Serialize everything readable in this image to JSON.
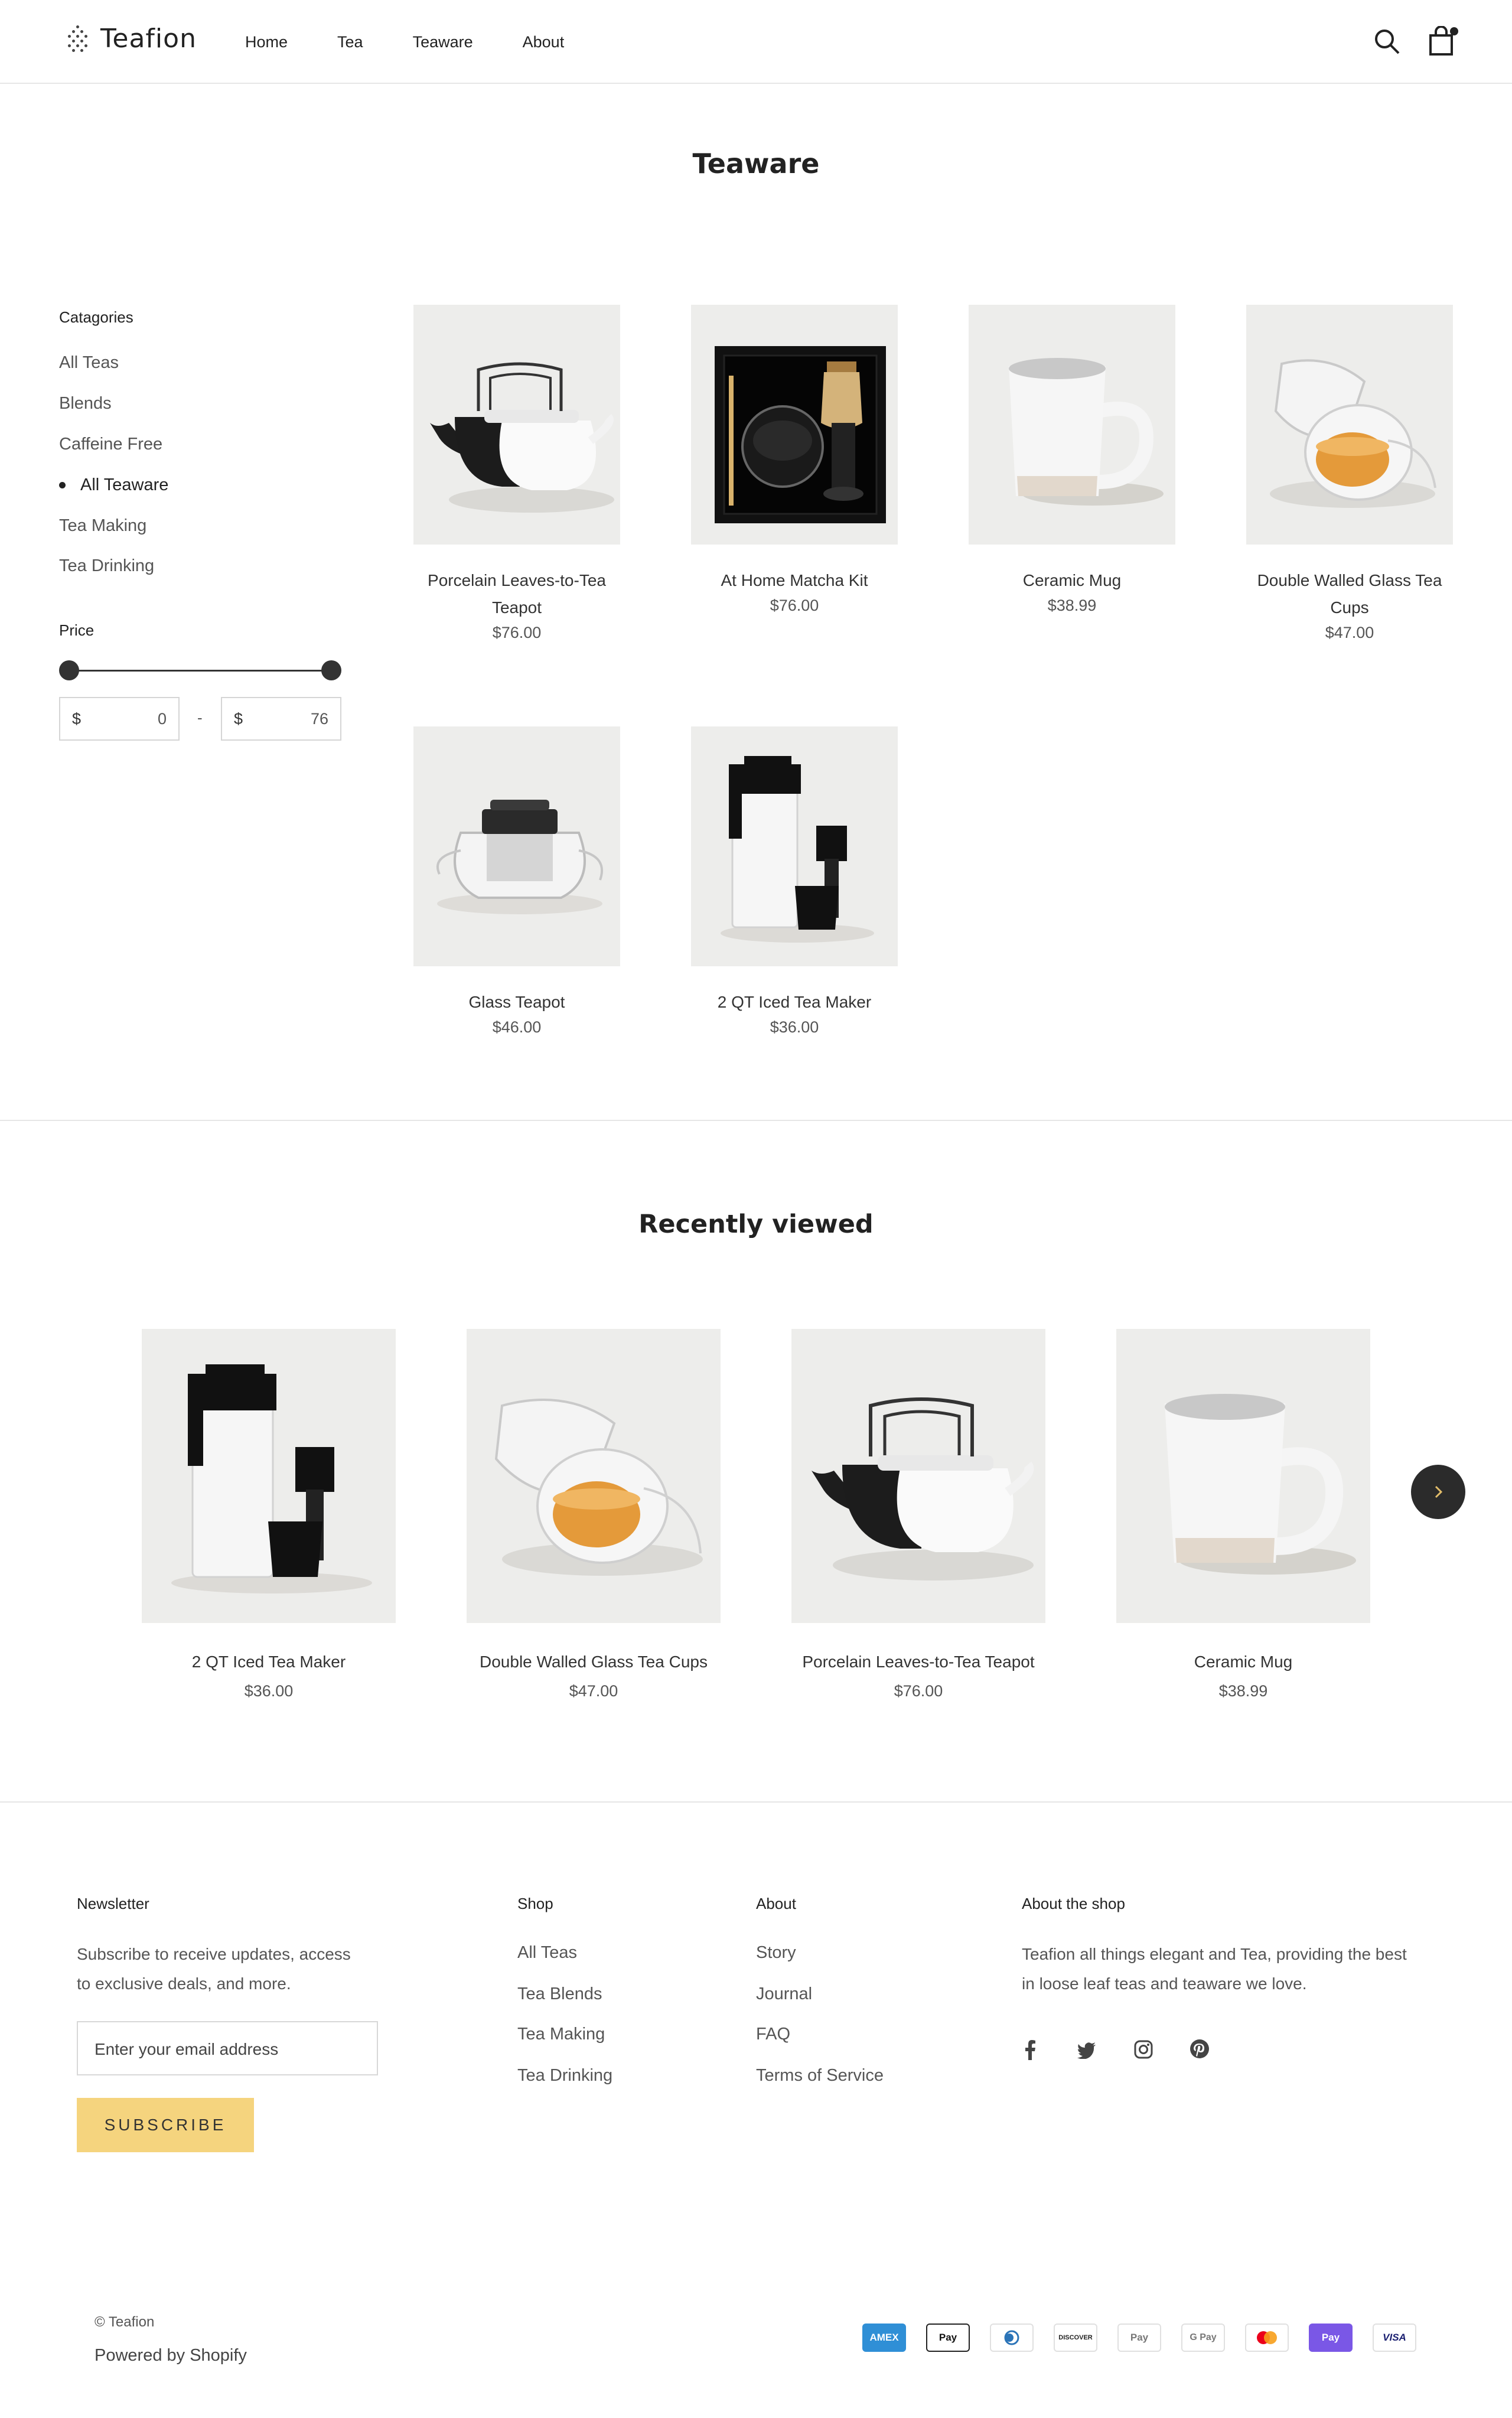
{
  "header": {
    "logo_text": "Teafion",
    "nav": [
      "Home",
      "Tea",
      "Teaware",
      "About"
    ],
    "icons": [
      "search-icon",
      "cart-icon"
    ]
  },
  "page": {
    "title": "Teaware"
  },
  "sidebar": {
    "categories_heading": "Catagories",
    "categories": [
      "All Teas",
      "Blends",
      "Caffeine Free",
      "All Teaware",
      "Tea Making",
      "Tea Drinking"
    ],
    "active_category": "All Teaware",
    "price_heading": "Price",
    "currency": "$",
    "price_min": "0",
    "price_max": "76",
    "price_separator": "-"
  },
  "products": [
    {
      "name": "Porcelain Leaves-to-Tea Teapot",
      "price": "$76.00"
    },
    {
      "name": "At Home Matcha Kit",
      "price": "$76.00"
    },
    {
      "name": "Ceramic Mug",
      "price": "$38.99"
    },
    {
      "name": "Double Walled Glass Tea Cups",
      "price": "$47.00"
    },
    {
      "name": "Glass Teapot",
      "price": "$46.00"
    },
    {
      "name": "2 QT Iced Tea Maker",
      "price": "$36.00"
    }
  ],
  "recently_viewed": {
    "title": "Recently viewed",
    "items": [
      {
        "name": "2 QT Iced Tea Maker",
        "price": "$36.00"
      },
      {
        "name": "Double Walled Glass Tea Cups",
        "price": "$47.00"
      },
      {
        "name": "Porcelain Leaves-to-Tea Teapot",
        "price": "$76.00"
      },
      {
        "name": "Ceramic Mug",
        "price": "$38.99"
      }
    ]
  },
  "footer": {
    "newsletter": {
      "heading": "Newsletter",
      "text_line1": "Subscribe to receive updates, access",
      "text_line2": "to exclusive deals, and more.",
      "placeholder": "Enter your email address",
      "button": "SUBSCRIBE"
    },
    "shop": {
      "heading": "Shop",
      "links": [
        "All Teas",
        "Tea Blends",
        "Tea Making",
        "Tea Drinking"
      ]
    },
    "about": {
      "heading": "About",
      "links": [
        "Story",
        "Journal",
        "FAQ",
        "Terms of Service"
      ]
    },
    "about_shop": {
      "heading": "About the shop",
      "text_line1": "Teafion all things elegant and Tea, providing the best",
      "text_line2": "in loose leaf teas and teaware we love.",
      "social": [
        "facebook-icon",
        "twitter-icon",
        "instagram-icon",
        "pinterest-icon"
      ]
    },
    "copyright": "© Teafion",
    "powered": "Powered by Shopify",
    "payments": [
      "AMEX",
      "Pay",
      "",
      "DISCOVER",
      "Pay",
      "G Pay",
      "",
      "Pay",
      "VISA"
    ]
  },
  "colors": {
    "accent": "#f5d47e",
    "text": "#2b2b2b",
    "muted": "#555555",
    "border": "#e6e6e6"
  }
}
